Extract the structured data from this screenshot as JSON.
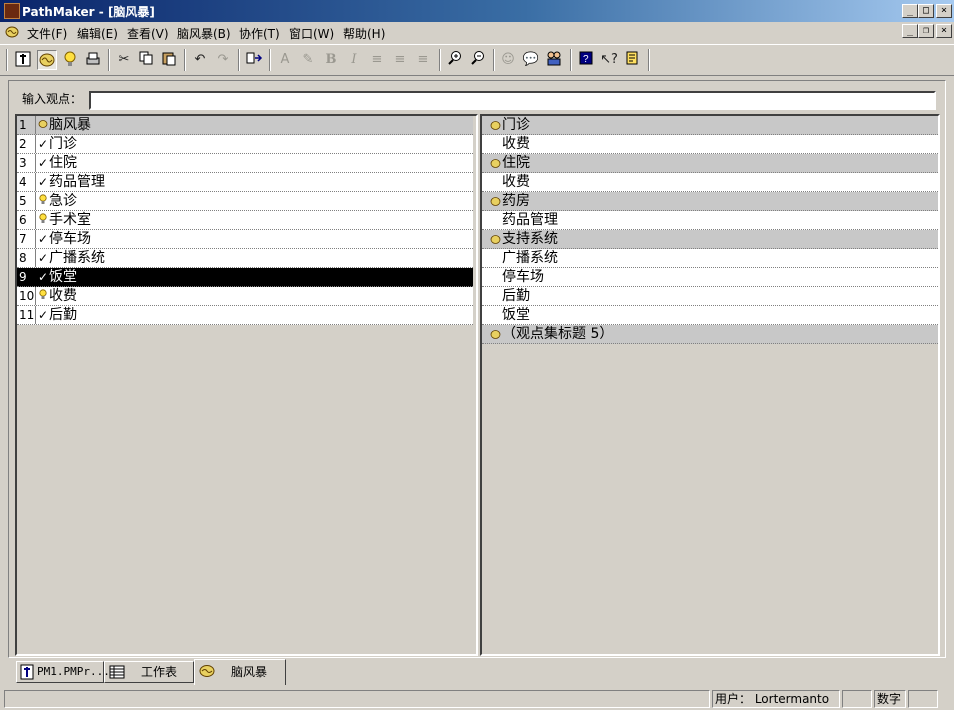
{
  "window": {
    "title": "PathMaker - [脑风暴]",
    "title_bar_color": "#0a246a"
  },
  "menu": {
    "items": [
      "文件(F)",
      "编辑(E)",
      "查看(V)",
      "脑风暴(B)",
      "协作(T)",
      "窗口(W)",
      "帮助(H)"
    ]
  },
  "toolbar": {
    "buttons": [
      "pathmaker-icon",
      "brainstorm-icon",
      "idea-bulb-icon",
      "print-icon",
      "cut-icon",
      "copy-icon",
      "paste-icon",
      "undo-icon",
      "redo-icon",
      "format-icon",
      "font-color-icon",
      "highlight-icon",
      "bold-icon",
      "italic-icon",
      "align-left-icon",
      "align-center-icon",
      "align-right-icon",
      "zoom-in-icon",
      "zoom-out-icon",
      "smiley-icon",
      "comment-icon",
      "people-icon",
      "help-book-icon",
      "whats-this-icon",
      "notes-icon"
    ],
    "bold_glyph": "B",
    "italic_glyph": "I"
  },
  "input": {
    "label": "输入观点：",
    "value": ""
  },
  "left_list": {
    "rows": [
      {
        "num": "1",
        "mark": "brainstorm-icon",
        "text": "脑风暴",
        "header": true
      },
      {
        "num": "2",
        "mark": "✓",
        "text": "门诊"
      },
      {
        "num": "3",
        "mark": "✓",
        "text": "住院"
      },
      {
        "num": "4",
        "mark": "✓",
        "text": "药品管理"
      },
      {
        "num": "5",
        "mark": "bulb-icon",
        "text": "急诊"
      },
      {
        "num": "6",
        "mark": "bulb-icon",
        "text": "手术室"
      },
      {
        "num": "7",
        "mark": "✓",
        "text": "停车场"
      },
      {
        "num": "8",
        "mark": "✓",
        "text": "广播系统"
      },
      {
        "num": "9",
        "mark": "✓",
        "text": "饭堂",
        "selected": true
      },
      {
        "num": "10",
        "mark": "bulb-icon",
        "text": "收费"
      },
      {
        "num": "11",
        "mark": "✓",
        "text": "后勤"
      }
    ]
  },
  "right_list": {
    "rows": [
      {
        "text": "门诊",
        "header": true
      },
      {
        "text": "收费"
      },
      {
        "text": "住院",
        "header": true
      },
      {
        "text": "收费"
      },
      {
        "text": "药房",
        "header": true
      },
      {
        "text": "药品管理"
      },
      {
        "text": "支持系统",
        "header": true
      },
      {
        "text": "广播系统"
      },
      {
        "text": "停车场"
      },
      {
        "text": "后勤"
      },
      {
        "text": "饭堂"
      },
      {
        "text": "（观点集标题 5）",
        "header": true
      }
    ]
  },
  "tabs": [
    {
      "label": "PM1.PMPr...",
      "icon": "pathmaker-doc-icon"
    },
    {
      "label": "工作表",
      "icon": "worksheet-icon"
    },
    {
      "label": "脑风暴",
      "icon": "brainstorm-icon",
      "active": true
    }
  ],
  "status": {
    "user": "用户： Lortermanto",
    "num": "数字"
  }
}
